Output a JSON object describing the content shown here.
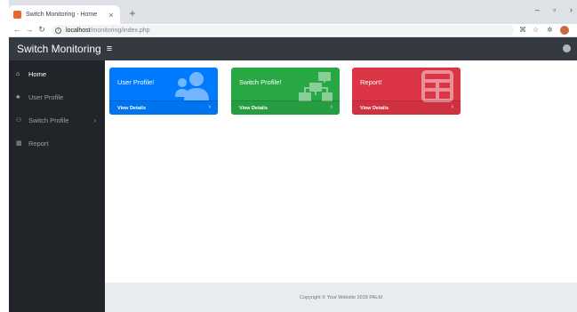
{
  "browser": {
    "tab_title": "Switch Monitoring - Home",
    "tab_close": "×",
    "new_tab": "+",
    "url_host": "localhost",
    "url_path": "/monitoring/index.php",
    "window_controls": [
      "–",
      "▫",
      "›"
    ]
  },
  "navbar": {
    "brand": "Switch Monitoring",
    "toggler": "≡"
  },
  "sidebar": {
    "items": [
      {
        "label": "Home",
        "icon": "home-icon",
        "active": true
      },
      {
        "label": "User Profile",
        "icon": "users-icon",
        "active": false
      },
      {
        "label": "Switch Profile",
        "icon": "sitemap-icon",
        "active": false,
        "has_chevron": true,
        "chevron": "›"
      },
      {
        "label": "Report",
        "icon": "table-icon",
        "active": false
      }
    ]
  },
  "cards": [
    {
      "title": "User Profile!",
      "link": "View Details",
      "arrow": "›",
      "color": "#007bff",
      "icon": "users-icon"
    },
    {
      "title": "Switch Profile!",
      "link": "View Details",
      "arrow": "›",
      "color": "#28a745",
      "icon": "sitemap-icon"
    },
    {
      "title": "Report!",
      "link": "View Details",
      "arrow": "›",
      "color": "#dc3545",
      "icon": "table-icon"
    }
  ],
  "footer": {
    "text": "Copyright © Your Website 2018 PALM"
  }
}
